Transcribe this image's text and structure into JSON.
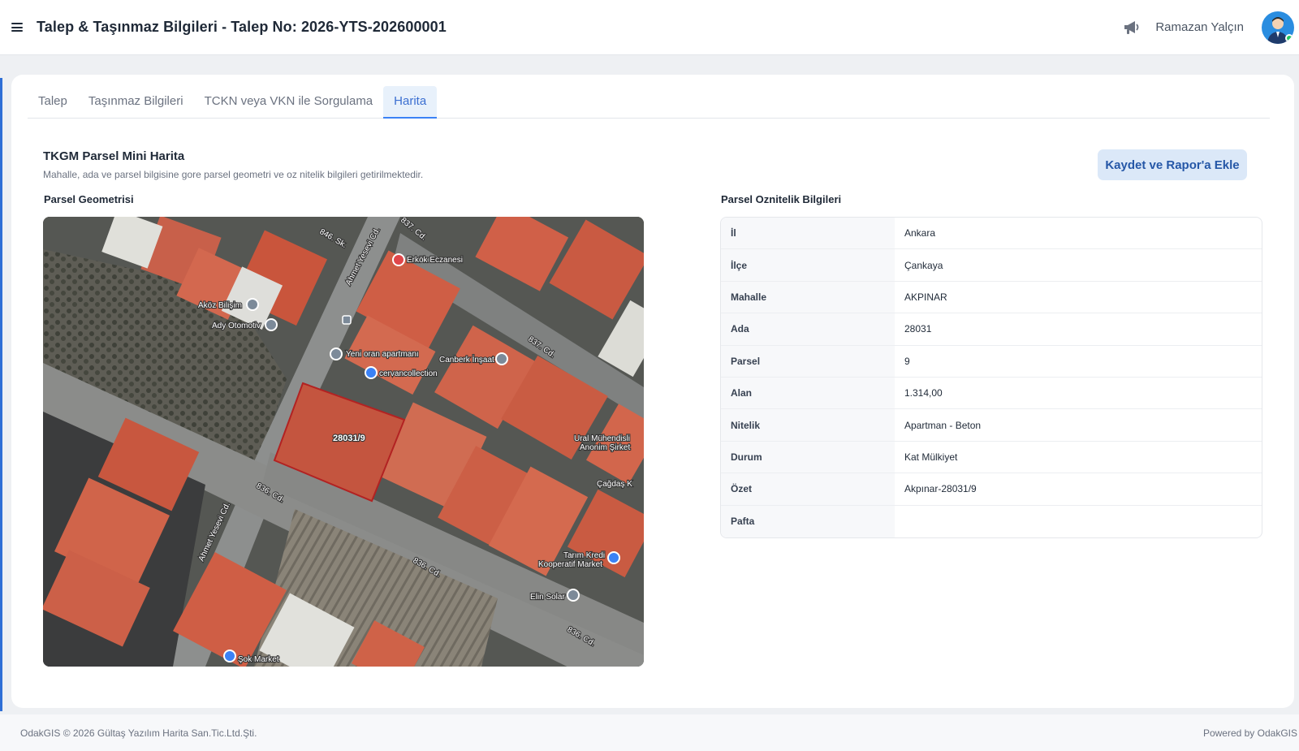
{
  "header": {
    "title": "Talep & Taşınmaz Bilgileri - Talep No: 2026-YTS-202600001",
    "user_name": "Ramazan Yalçın",
    "menu_icon": "hamburger-menu-icon",
    "announce_icon": "megaphone-icon",
    "status_color": "#22c55e"
  },
  "tabs": [
    {
      "label": "Talep",
      "active": false
    },
    {
      "label": "Taşınmaz Bilgileri",
      "active": false
    },
    {
      "label": "TCKN veya VKN ile Sorgulama",
      "active": false
    },
    {
      "label": "Harita",
      "active": true
    }
  ],
  "section": {
    "title": "TKGM Parsel Mini Harita",
    "subtitle": "Mahalle, ada ve parsel bilgisine gore parsel geometri ve oz nitelik bilgileri getirilmektedir.",
    "save_button": "Kaydet ve Rapor'a Ekle"
  },
  "geometry": {
    "label": "Parsel Geometrisi",
    "parcel_label": "28031/9",
    "map_labels": {
      "road_846": "846. Sk.",
      "road_ahmet_yesevi_top": "Ahmet Yesevi Cd.",
      "road_837_top": "837. Cd.",
      "road_837_mid": "837. Cd.",
      "road_836_left": "836. Cd.",
      "road_ahmet_yesevi_bottom": "Ahmet Yesevi Cd.",
      "road_836_mid": "836. Cd.",
      "road_836_bottom": "836. Cd.",
      "poi_erkok": "Erkök Eczanesi",
      "poi_akoz": "Aköz Bilişim",
      "poi_ady": "Ady Otomotiv",
      "poi_yeni": "Yeni oran apartmanı",
      "poi_canberk": "Canberk İnşaat",
      "poi_cervan": "cervancollection",
      "poi_ural_1": "Ural Mühendisli",
      "poi_ural_2": "Anonim Şirket",
      "poi_cagdas": "Çağdaş K",
      "poi_tarim_1": "Tarım Kredi",
      "poi_tarim_2": "Kooperatif Market",
      "poi_elin": "Elin Solar",
      "poi_sok": "Şok Market"
    }
  },
  "attributes": {
    "label": "Parsel Oznitelik Bilgileri",
    "rows": [
      {
        "key": "İl",
        "value": "Ankara"
      },
      {
        "key": "İlçe",
        "value": "Çankaya"
      },
      {
        "key": "Mahalle",
        "value": "AKPINAR"
      },
      {
        "key": "Ada",
        "value": "28031"
      },
      {
        "key": "Parsel",
        "value": "9"
      },
      {
        "key": "Alan",
        "value": "1.314,00"
      },
      {
        "key": "Nitelik",
        "value": "Apartman - Beton"
      },
      {
        "key": "Durum",
        "value": "Kat Mülkiyet"
      },
      {
        "key": "Özet",
        "value": "Akpınar-28031/9"
      },
      {
        "key": "Pafta",
        "value": ""
      }
    ]
  },
  "footer": {
    "left": "OdakGIS © 2026 Gültaş Yazılım Harita San.Tic.Ltd.Şti.",
    "right": "Powered by OdakGIS"
  },
  "colors": {
    "accent": "#3b82f6",
    "parcel_outline": "#c0392b",
    "button_bg": "#dbe8f8",
    "button_text": "#2557a7"
  }
}
